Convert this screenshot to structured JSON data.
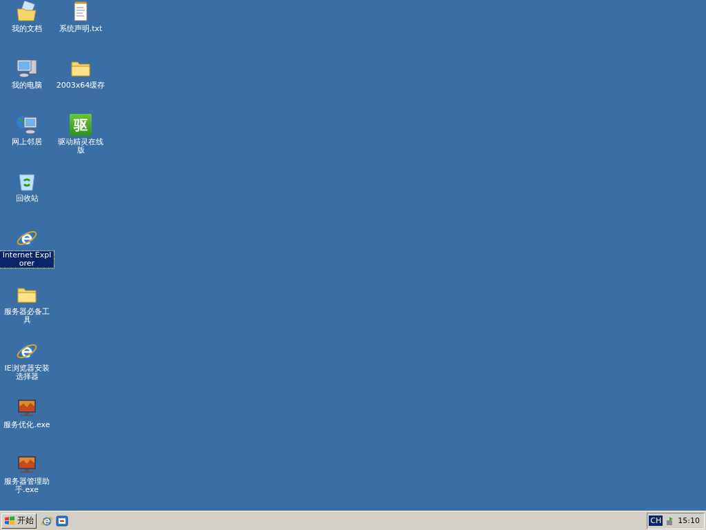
{
  "desktop": {
    "columns": [
      [
        {
          "kind": "documents",
          "label": "我的文档",
          "selected": false
        },
        {
          "kind": "computer",
          "label": "我的电脑",
          "selected": false
        },
        {
          "kind": "network",
          "label": "网上邻居",
          "selected": false
        },
        {
          "kind": "recycle",
          "label": "回收站",
          "selected": false
        },
        {
          "kind": "ie",
          "label": "Internet Explorer",
          "selected": true
        },
        {
          "kind": "folder",
          "label": "服务器必备工具",
          "selected": false
        },
        {
          "kind": "ie",
          "label": "IE浏览器安装选择器",
          "selected": false
        },
        {
          "kind": "program",
          "label": "服务优化.exe",
          "selected": false
        },
        {
          "kind": "program",
          "label": "服务器管理助手.exe",
          "selected": false
        }
      ],
      [
        {
          "kind": "textfile",
          "label": "系统声明.txt",
          "selected": false
        },
        {
          "kind": "folder",
          "label": "2003x64缓存",
          "selected": false
        },
        {
          "kind": "app",
          "label": "驱动精灵在线版",
          "badge": "驱",
          "selected": false
        }
      ]
    ]
  },
  "taskbar": {
    "start": "开始",
    "quick_launch": [
      {
        "kind": "ie"
      },
      {
        "kind": "desktop"
      }
    ],
    "tray": {
      "language": "CH",
      "clock": "15:10"
    }
  }
}
